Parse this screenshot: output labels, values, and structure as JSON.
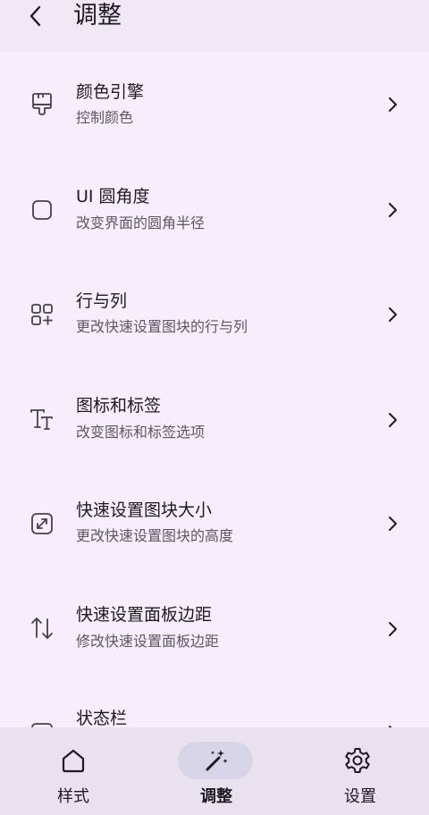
{
  "header": {
    "title": "调整"
  },
  "items": [
    {
      "title": "颜色引擎",
      "subtitle": "控制颜色",
      "icon": "paint-bucket-icon"
    },
    {
      "title": "UI 圆角度",
      "subtitle": "改变界面的圆角半径",
      "icon": "rounded-square-icon"
    },
    {
      "title": "行与列",
      "subtitle": "更改快速设置图块的行与列",
      "icon": "grid-add-icon"
    },
    {
      "title": "图标和标签",
      "subtitle": "改变图标和标签选项",
      "icon": "text-format-icon"
    },
    {
      "title": "快速设置图块大小",
      "subtitle": "更改快速设置图块的高度",
      "icon": "resize-icon"
    },
    {
      "title": "快速设置面板边距",
      "subtitle": "修改快速设置面板边距",
      "icon": "swap-vertical-icon"
    },
    {
      "title": "状态栏",
      "subtitle": "",
      "icon": "status-bar-icon"
    }
  ],
  "nav": {
    "items": [
      {
        "label": "样式",
        "icon": "home-icon",
        "active": false
      },
      {
        "label": "调整",
        "icon": "magic-wand-icon",
        "active": true
      },
      {
        "label": "设置",
        "icon": "gear-icon",
        "active": false
      }
    ]
  },
  "colors": {
    "background": "#f6eefb",
    "top_bar": "#efe7f3",
    "nav_bar": "#e9e1ef",
    "nav_active_pill": "#d7d4e8",
    "icon_stroke": "#454050"
  }
}
